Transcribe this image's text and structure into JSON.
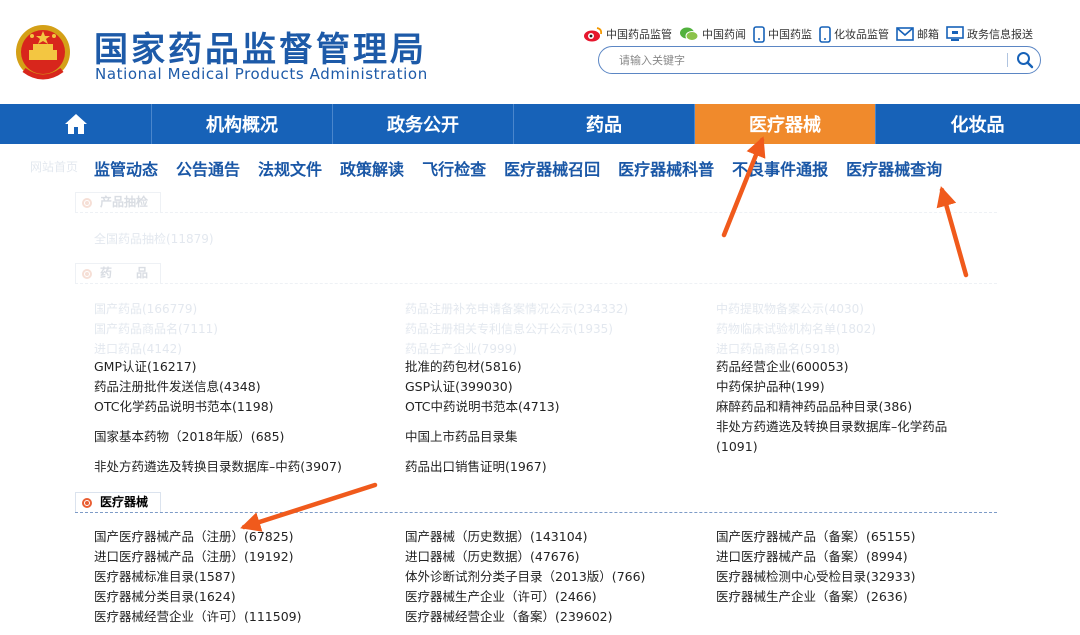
{
  "header": {
    "title_cn": "国家药品监督管理局",
    "title_en": "National Medical Products Administration",
    "top_links": [
      {
        "label": "中国药品监管",
        "icon": "weibo-icon"
      },
      {
        "label": "中国药闻",
        "icon": "wechat-icon"
      },
      {
        "label": "中国药监",
        "icon": "mobile-icon"
      },
      {
        "label": "化妆品监管",
        "icon": "mobile-icon"
      },
      {
        "label": "邮箱",
        "icon": "mail-icon"
      },
      {
        "label": "政务信息报送",
        "icon": "monitor-icon"
      }
    ],
    "search": {
      "placeholder": "请输入关键字"
    }
  },
  "nav": {
    "home_icon": "home-icon",
    "items": [
      "机构概况",
      "政务公开",
      "药品",
      "医疗器械",
      "化妆品"
    ],
    "active": "医疗器械"
  },
  "subnav": {
    "items": [
      "监管动态",
      "公告通告",
      "法规文件",
      "政策解读",
      "飞行检查",
      "医疗器械召回",
      "医疗器械科普",
      "不良事件通报",
      "医疗器械查询"
    ]
  },
  "faded_text": {
    "breadcrumb": "网站首页",
    "sec_sampling": "产品抽检",
    "sampling_item": "全国药品抽检(11879)",
    "sec_drugs": "药　　品",
    "drug_rows": [
      [
        "国产药品(166779)",
        "药品注册补充申请备案情况公示(234332)",
        "中药提取物备案公示(4030)"
      ],
      [
        "国产药品商品名(7111)",
        "药品注册相关专利信息公开公示(1935)",
        "药物临床试验机构名单(1802)"
      ],
      [
        "进口药品(4142)",
        "药品生产企业(7999)",
        "进口药品商品名(5918)"
      ]
    ]
  },
  "drugs": {
    "rows": [
      [
        "GMP认证(16217)",
        "批准的药包材(5816)",
        "药品经营企业(600053)"
      ],
      [
        "药品注册批件发送信息(4348)",
        "GSP认证(399030)",
        "中药保护品种(199)"
      ],
      [
        "OTC化学药品说明书范本(1198)",
        "OTC中药说明书范本(4713)",
        "麻醉药品和精神药品品种目录(386)"
      ]
    ],
    "row4": [
      "国家基本药物（2018年版）(685)",
      "中国上市药品目录集",
      "非处方药遴选及转换目录数据库–化学药品"
    ],
    "row4_extra": "(1091)",
    "row5": [
      "非处方药遴选及转换目录数据库–中药(3907)",
      "药品出口销售证明(1967)"
    ]
  },
  "devices": {
    "section_title": "医疗器械",
    "rows": [
      [
        "国产医疗器械产品（注册）(67825)",
        "国产器械（历史数据）(143104)",
        "国产医疗器械产品（备案）(65155)"
      ],
      [
        "进口医疗器械产品（注册）(19192)",
        "进口器械（历史数据）(47676)",
        "进口医疗器械产品（备案）(8994)"
      ],
      [
        "医疗器械标准目录(1587)",
        "体外诊断试剂分类子目录（2013版）(766)",
        "医疗器械检测中心受检目录(32933)"
      ],
      [
        "医疗器械分类目录(1624)",
        "医疗器械生产企业（许可）(2466)",
        "医疗器械生产企业（备案）(2636)"
      ],
      [
        "医疗器械经营企业（许可）(111509)",
        "医疗器械经营企业（备案）(239602)"
      ]
    ]
  },
  "colors": {
    "brand_blue": "#1762b8",
    "title_blue": "#1d5aa8",
    "active_orange": "#f08a2c",
    "arrow_orange": "#f05a1c"
  },
  "annotations": {
    "arrow_count": 3,
    "arrow_icon": "arrow-annotation-icon"
  }
}
